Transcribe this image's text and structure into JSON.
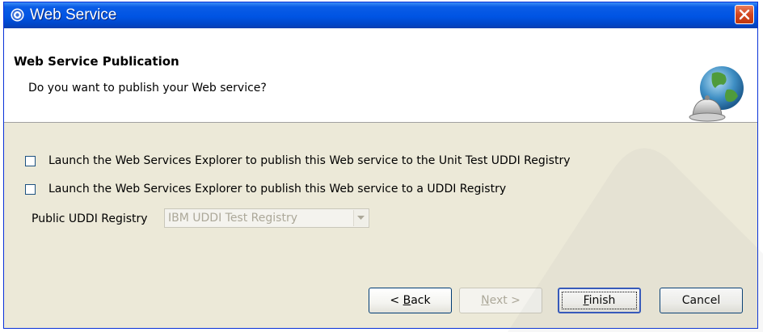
{
  "window": {
    "title": "Web Service",
    "icon": "swirl-app-icon"
  },
  "header": {
    "title": "Web Service Publication",
    "description": "Do you want to publish your Web service?",
    "icon": "globe-bell-icon"
  },
  "options": [
    {
      "label": "Launch the Web Services Explorer to publish this Web service to the Unit Test UDDI Registry",
      "checked": false
    },
    {
      "label": "Launch the Web Services Explorer to publish this Web service to a UDDI Registry",
      "checked": false
    }
  ],
  "registry": {
    "label": "Public UDDI Registry",
    "value": "IBM UDDI Test Registry",
    "enabled": false
  },
  "buttons": {
    "back": {
      "mnemonic": "B",
      "rest": "ack",
      "prefix": "< "
    },
    "next": {
      "mnemonic": "N",
      "rest": "ext >"
    },
    "finish": {
      "mnemonic": "F",
      "rest": "inish"
    },
    "cancel": "Cancel"
  }
}
